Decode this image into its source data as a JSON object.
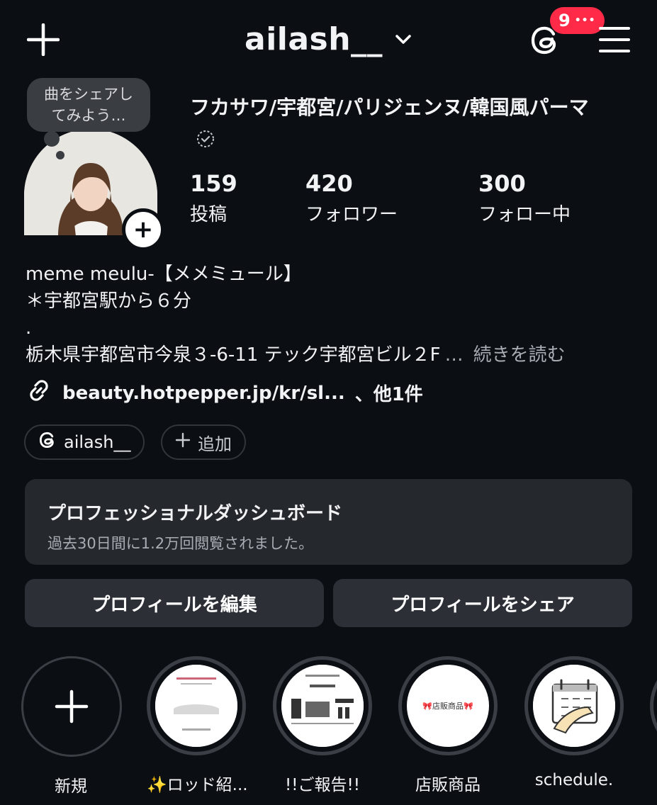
{
  "header": {
    "username": "ailash__",
    "threads_badge": "9",
    "threads_badge_more": "•••"
  },
  "profile": {
    "note": "曲をシェアし\nてみよう…",
    "display_name": "フカサワ/宇都宮/パリジェンヌ/韓国風パーマ",
    "stats": [
      {
        "value": "159",
        "label": "投稿"
      },
      {
        "value": "420",
        "label": "フォロワー"
      },
      {
        "value": "300",
        "label": "フォロー中"
      }
    ],
    "bio_lines": [
      "meme meulu-【メメミュール】",
      "＊宇都宮駅から６分",
      ".",
      "栃木県宇都宮市今泉３-6-11 テック宇都宮ビル２F"
    ],
    "bio_more_ellipsis": "…",
    "bio_more": "続きを読む",
    "link_text": "beauty.hotpepper.jp/kr/sl...",
    "link_more": "、他1件"
  },
  "chips": {
    "threads": "ailash__",
    "add": "追加"
  },
  "dashboard": {
    "title": "プロフェッショナルダッシュボード",
    "subtitle": "過去30日間に1.2万回閲覧されました。"
  },
  "buttons": {
    "edit": "プロフィールを編集",
    "share": "プロフィールをシェア"
  },
  "highlights": [
    {
      "label": "新規"
    },
    {
      "label": "✨ロッド紹..."
    },
    {
      "label": "!!ご報告!!"
    },
    {
      "label": "店販商品",
      "cover_text": "🎀店販商品🎀"
    },
    {
      "label": "schedule."
    }
  ],
  "colors": {
    "background": "#0b0f14",
    "badge": "#ff2a48",
    "card": "#25292e",
    "button": "#2c3036"
  }
}
